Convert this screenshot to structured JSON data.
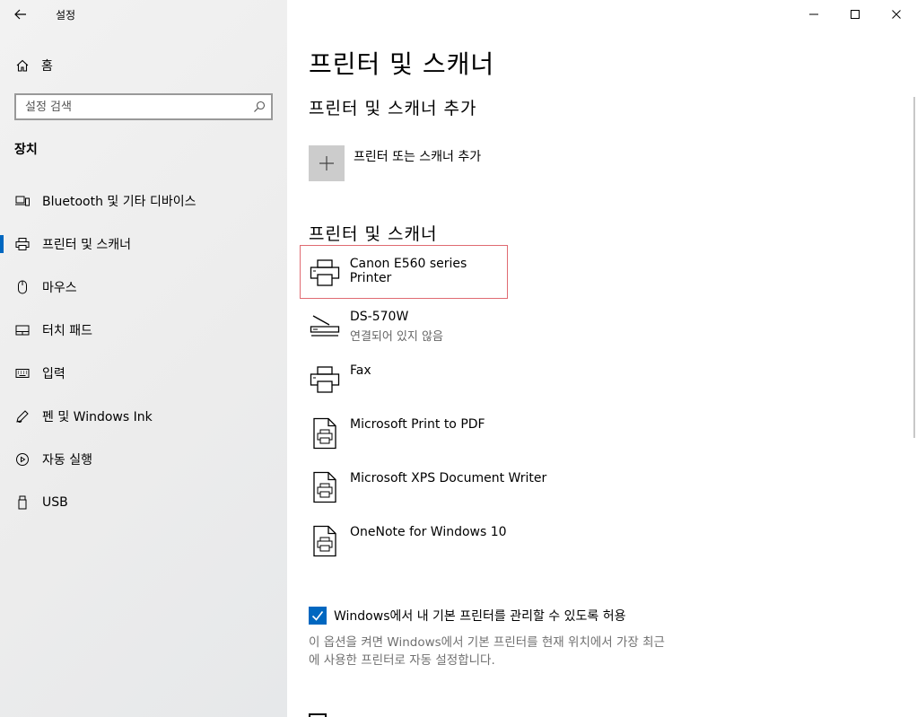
{
  "window": {
    "title": "설정",
    "back_icon": "arrow-left-icon",
    "controls": [
      "minimize-icon",
      "maximize-icon",
      "close-icon"
    ]
  },
  "sidebar": {
    "home_label": "홈",
    "search_placeholder": "설정 검색",
    "section_label": "장치",
    "items": [
      {
        "label": "Bluetooth 및 기타 디바이스",
        "icon": "bluetooth-devices-icon"
      },
      {
        "label": "프린터 및 스캐너",
        "icon": "printer-icon",
        "active": true
      },
      {
        "label": "마우스",
        "icon": "mouse-icon"
      },
      {
        "label": "터치 패드",
        "icon": "touchpad-icon"
      },
      {
        "label": "입력",
        "icon": "keyboard-icon"
      },
      {
        "label": "펜 및 Windows Ink",
        "icon": "pen-icon"
      },
      {
        "label": "자동 실행",
        "icon": "autoplay-icon"
      },
      {
        "label": "USB",
        "icon": "usb-icon"
      }
    ]
  },
  "main": {
    "title": "프린터 및 스캐너",
    "add_section_title": "프린터 및 스캐너 추가",
    "add_button_label": "프린터 또는 스캐너 추가",
    "list_title": "프린터 및 스캐너",
    "devices": [
      {
        "name": "Canon E560 series Printer",
        "status": "",
        "icon": "printer-icon",
        "selected": true
      },
      {
        "name": "DS-570W",
        "status": "연결되어 있지 않음",
        "icon": "scanner-icon"
      },
      {
        "name": "Fax",
        "icon": "printer-icon"
      },
      {
        "name": "Microsoft Print to PDF",
        "icon": "document-printer-icon"
      },
      {
        "name": "Microsoft XPS Document Writer",
        "icon": "document-printer-icon"
      },
      {
        "name": "OneNote for Windows 10",
        "icon": "document-printer-icon"
      }
    ],
    "default_printer_checkbox": {
      "label": "Windows에서 내 기본 프린터를 관리할 수 있도록 허용",
      "checked": true
    },
    "help_text_line1": "이 옵션을 켜면 Windows에서 기본 프린터를 현재 위치에서 가장 최근",
    "help_text_line2": "에 사용한 프린터로 자동 설정합니다."
  },
  "colors": {
    "accent": "#0067c0",
    "selection_border": "#e06b72",
    "sidebar_bg": "#f2f2f2",
    "secondary_text": "#666666"
  }
}
